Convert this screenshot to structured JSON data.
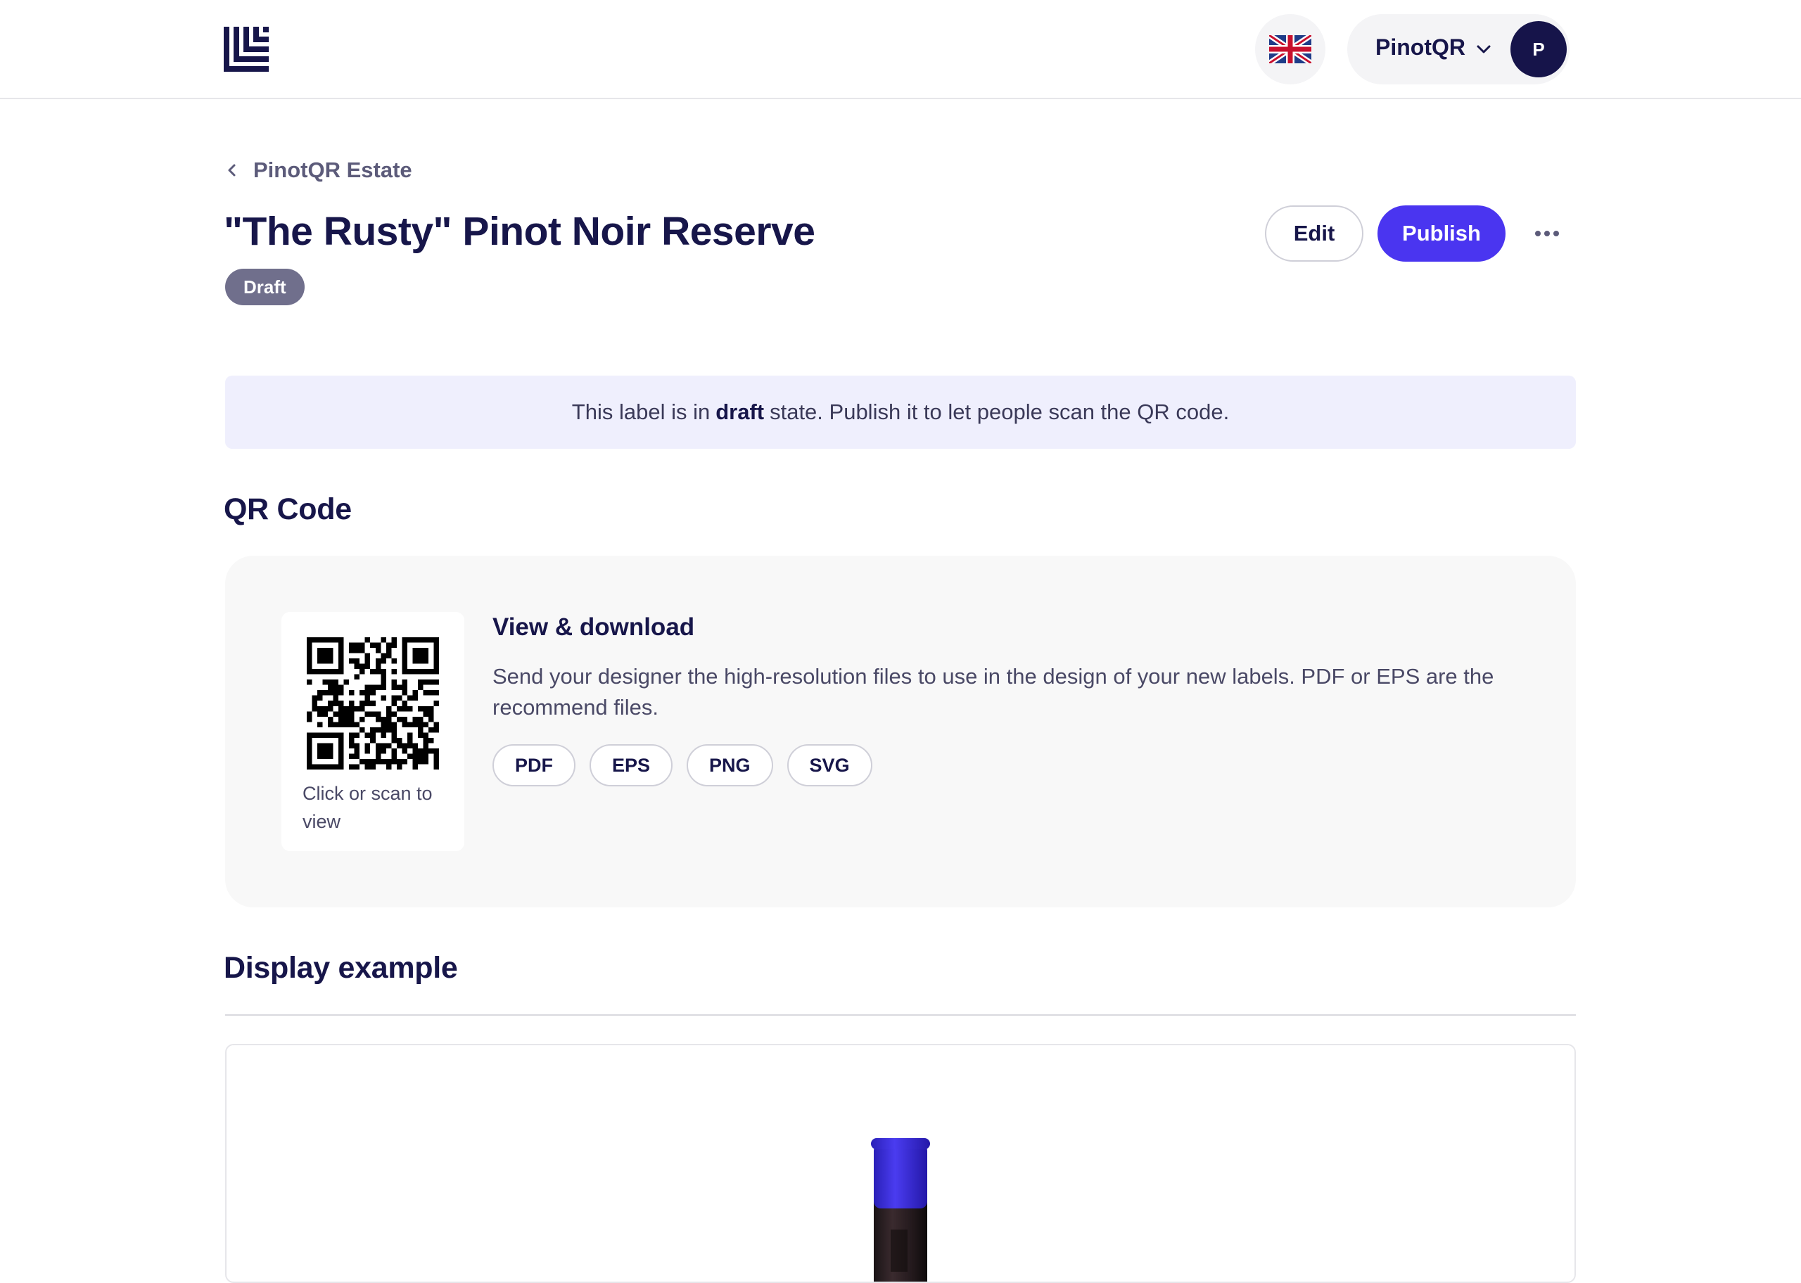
{
  "header": {
    "language_icon": "uk-flag-icon",
    "account_name": "PinotQR",
    "avatar_initial": "P"
  },
  "breadcrumb": {
    "label": "PinotQR Estate"
  },
  "page": {
    "title": "\"The Rusty\" Pinot Noir Reserve",
    "status": "Draft",
    "edit_label": "Edit",
    "publish_label": "Publish",
    "more_icon": "more-horizontal-icon"
  },
  "notice": {
    "before": "This label is in",
    "emphasis": "draft",
    "after": "state. Publish it to let people scan the QR code."
  },
  "qr_section": {
    "title": "QR Code",
    "tile_caption": "Click or scan to view",
    "card_title": "View & download",
    "card_description": "Send your designer the high-resolution files to use in the design of your new labels. PDF or EPS are the recommend files.",
    "formats": [
      "PDF",
      "EPS",
      "PNG",
      "SVG"
    ]
  },
  "display_section": {
    "title": "Display example"
  },
  "colors": {
    "primary": "#4a35f0",
    "navy": "#17164a",
    "notice_bg": "#efeffd",
    "badge": "#706f8c",
    "card_bg": "#f8f8f8",
    "capsule": "#3b2fd6"
  }
}
